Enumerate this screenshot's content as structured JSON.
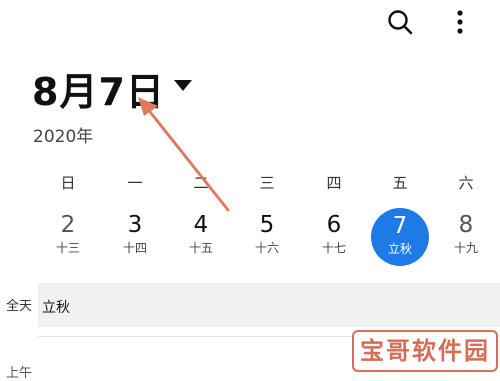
{
  "header": {
    "date_title": "8月7日",
    "year": "2020年",
    "icons": {
      "search": "search-icon",
      "more": "more-vertical-icon",
      "dropdown": "caret-down-icon"
    }
  },
  "week": {
    "weekdays": [
      "日",
      "一",
      "二",
      "三",
      "四",
      "五",
      "六"
    ],
    "days": [
      {
        "num": "2",
        "lunar": "十三"
      },
      {
        "num": "3",
        "lunar": "十四"
      },
      {
        "num": "4",
        "lunar": "十五"
      },
      {
        "num": "5",
        "lunar": "十六"
      },
      {
        "num": "6",
        "lunar": "十七"
      },
      {
        "num": "7",
        "lunar": "立秋"
      },
      {
        "num": "8",
        "lunar": "十九"
      }
    ],
    "selected_index": 5
  },
  "schedule": {
    "allday_label": "全天",
    "allday_event": "立秋",
    "am_label": "上午"
  },
  "watermark": "宝哥软件园",
  "colors": {
    "accent": "#1e7be6",
    "annotation": "#e07a5f",
    "allday_bg": "#f1f1f1"
  }
}
